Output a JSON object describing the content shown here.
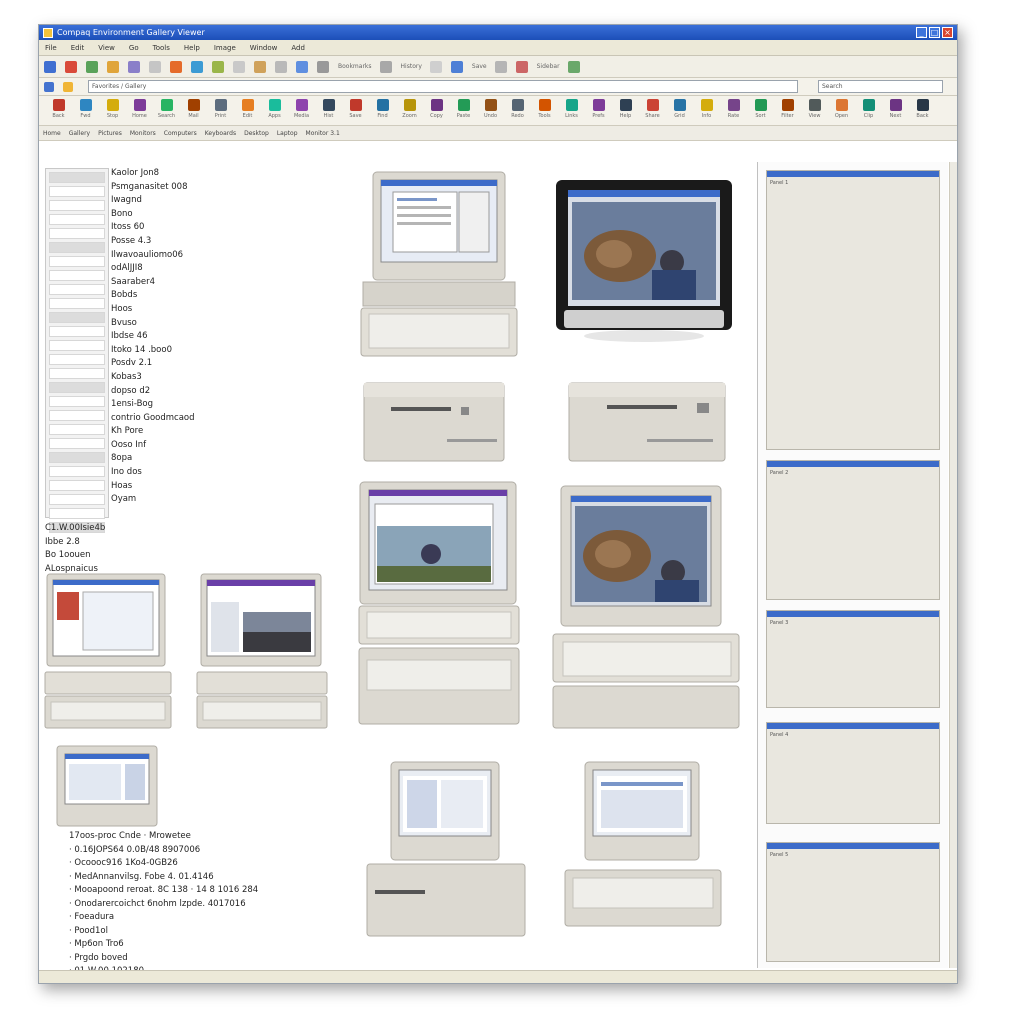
{
  "window": {
    "title": "Compaq Environment Gallery Viewer",
    "colors": {
      "titlebar": "#1c4fb8",
      "chrome": "#ece9d8",
      "case": "#dcd9d1",
      "screen_bezel": "#1a1a1a"
    }
  },
  "menu": [
    "File",
    "Edit",
    "View",
    "Go",
    "Tools",
    "Help",
    "Image",
    "Window",
    "Add"
  ],
  "toolbar": {
    "label_1": "Bookmarks",
    "label_2": "History",
    "label_3": "Save",
    "label_4": "Sidebar"
  },
  "address": {
    "value": "Favorites / Gallery",
    "placeholder": "Search"
  },
  "icon_bar": [
    "Back",
    "Fwd",
    "Stop",
    "Home",
    "Search",
    "Mail",
    "Print",
    "Edit",
    "Apps",
    "Media",
    "Hist",
    "Save",
    "Find",
    "Zoom",
    "Copy",
    "Paste",
    "Undo",
    "Redo",
    "Tools",
    "Links",
    "Prefs",
    "Help",
    "Share",
    "Grid",
    "Info",
    "Rate",
    "Sort",
    "Filter",
    "View",
    "Open",
    "Clip",
    "Next",
    "Back"
  ],
  "tabs": [
    "Home",
    "Gallery",
    "Pictures",
    "Monitors",
    "Computers",
    "Keyboards",
    "Desktop",
    "Laptop",
    "Monitor 3.1"
  ],
  "info_list": [
    "Kaolor Jon8",
    "Psmganasitet 008",
    "Iwagnd",
    "Bono",
    "Itoss 60",
    "Posse 4.3",
    "Ilwavoauliomo06",
    "odAlJJI8",
    "Saaraber4",
    "Bobds",
    "Hoos",
    "Bvuso",
    "Ibdse 46",
    "Itoko 14 .boo0",
    "Posdv 2.1",
    "Kobas3",
    "dopso d2",
    "1ensi-Bog",
    "contrio Goodmcaod",
    "Kh Pore",
    "Ooso Inf",
    "8opa",
    "Ino dos",
    "Hoas",
    "Oyam"
  ],
  "left_meta": [
    "C1.W.00Isie4b",
    "Ibbe 2.8",
    "Bo 1oouen",
    "ALospnaicus"
  ],
  "bullets": [
    "17oos-proc Cnde · Mrowetee",
    "· 0.16JOPS64 0.0B/48 8907006",
    "· Ocoooc916 1Ko4-0GB26",
    "· MedAnnanvilsg. Fobe 4. 01.4146",
    "· Mooapoond reroat. 8C 138 · 14 8 1016 284",
    "· Onodarercoichct 6nohm lzpde. 4017016",
    "· Foeadura",
    "· Pood1ol",
    "· Mp6on Tro6",
    "· Prgdo boved",
    "· 01.W.00.102180"
  ],
  "right_panel_labels": [
    "Panel 1",
    "Panel 2",
    "Panel 3",
    "Panel 4",
    "Panel 5"
  ]
}
